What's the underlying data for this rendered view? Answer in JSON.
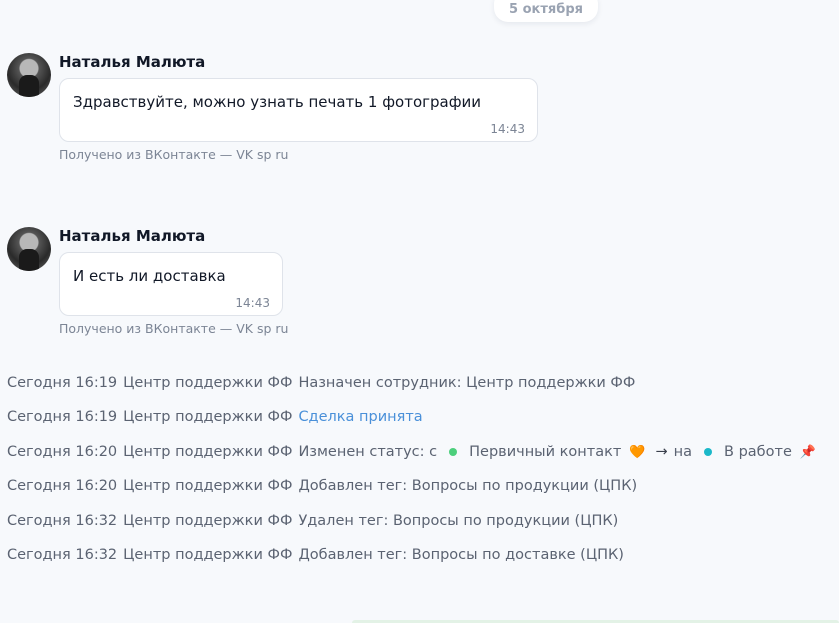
{
  "date_divider": "5 октября",
  "messages": [
    {
      "sender": "Наталья Малюта",
      "text": "Здравствуйте, можно узнать печать 1 фотографии",
      "time": "14:43",
      "source": "Получено из ВКонтакте — VK sp ru"
    },
    {
      "sender": "Наталья Малюта",
      "text": "И есть ли доставка",
      "time": "14:43",
      "source": "Получено из ВКонтакте — VK sp ru"
    }
  ],
  "events": [
    {
      "time": "Сегодня 16:19",
      "actor": "Центр поддержки ФФ",
      "action": "Назначен сотрудник: Центр поддержки ФФ"
    },
    {
      "time": "Сегодня 16:19",
      "actor": "Центр поддержки ФФ",
      "action": "Сделка принята"
    },
    {
      "time": "Сегодня 16:20",
      "actor": "Центр поддержки ФФ",
      "action": "Изменен статус: с",
      "from_status": "Первичный контакт",
      "from_emoji": "🧡",
      "from_color": "#4ccf7c",
      "arrow": "→",
      "to_word": "на",
      "to_status": "В работе",
      "to_emoji": "📌",
      "to_color": "#1bb8c9"
    },
    {
      "time": "Сегодня 16:20",
      "actor": "Центр поддержки ФФ",
      "action": "Добавлен тег: Вопросы по продукции (ЦПК)"
    },
    {
      "time": "Сегодня 16:32",
      "actor": "Центр поддержки ФФ",
      "action": "Удален тег: Вопросы по продукции (ЦПК)"
    },
    {
      "time": "Сегодня 16:32",
      "actor": "Центр поддержки ФФ",
      "action": "Добавлен тег: Вопросы по доставке (ЦПК)"
    }
  ],
  "colors": {
    "link": "#4a90d9",
    "background": "#f7f9fc"
  }
}
